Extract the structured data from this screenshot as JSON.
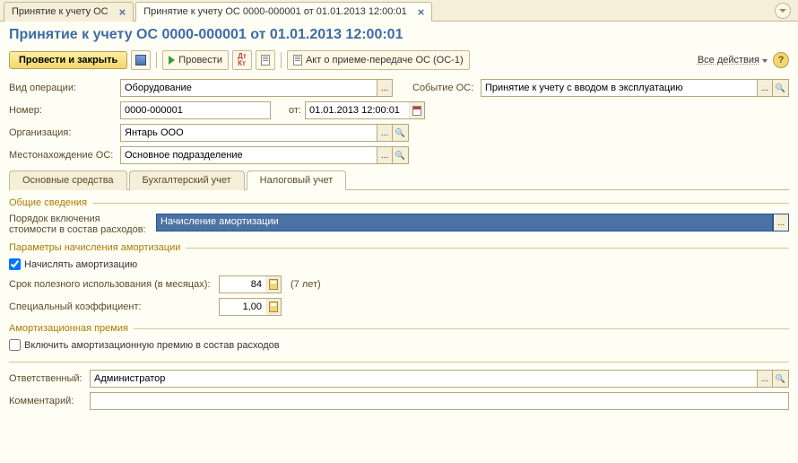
{
  "tabs": [
    {
      "label": "Принятие к учету ОС"
    },
    {
      "label": "Принятие к учету ОС 0000-000001 от 01.01.2013 12:00:01"
    }
  ],
  "title": "Принятие к учету ОС 0000-000001 от 01.01.2013 12:00:01",
  "toolbar": {
    "main_btn": "Провести и закрыть",
    "provesti": "Провести",
    "akt": "Акт о приеме-передаче ОС (ОС-1)",
    "all_actions": "Все действия"
  },
  "form": {
    "op_type_label": "Вид операции:",
    "op_type": "Оборудование",
    "event_label": "Событие ОС:",
    "event": "Принятие к учету с вводом в эксплуатацию",
    "number_label": "Номер:",
    "number": "0000-000001",
    "date_label": "от:",
    "date": "01.01.2013 12:00:01",
    "org_label": "Организация:",
    "org": "Янтарь ООО",
    "location_label": "Местонахождение ОС:",
    "location": "Основное подразделение"
  },
  "subtabs": [
    "Основные средства",
    "Бухгалтерский учет",
    "Налоговый учет"
  ],
  "tax": {
    "general_title": "Общие сведения",
    "order_label_1": "Порядок включения",
    "order_label_2": "стоимости в состав расходов:",
    "order_value": "Начисление амортизации",
    "amort_title": "Параметры начисления амортизации",
    "amort_check": "Начислять амортизацию",
    "life_label": "Срок полезного использования (в месяцах):",
    "life_value": "84",
    "life_years": "(7 лет)",
    "coef_label": "Специальный коэффициент:",
    "coef_value": "1,00",
    "bonus_title": "Амортизационная премия",
    "bonus_check": "Включить амортизационную премию в состав расходов"
  },
  "footer": {
    "resp_label": "Ответственный:",
    "resp": "Администратор",
    "comment_label": "Комментарий:",
    "comment": ""
  }
}
